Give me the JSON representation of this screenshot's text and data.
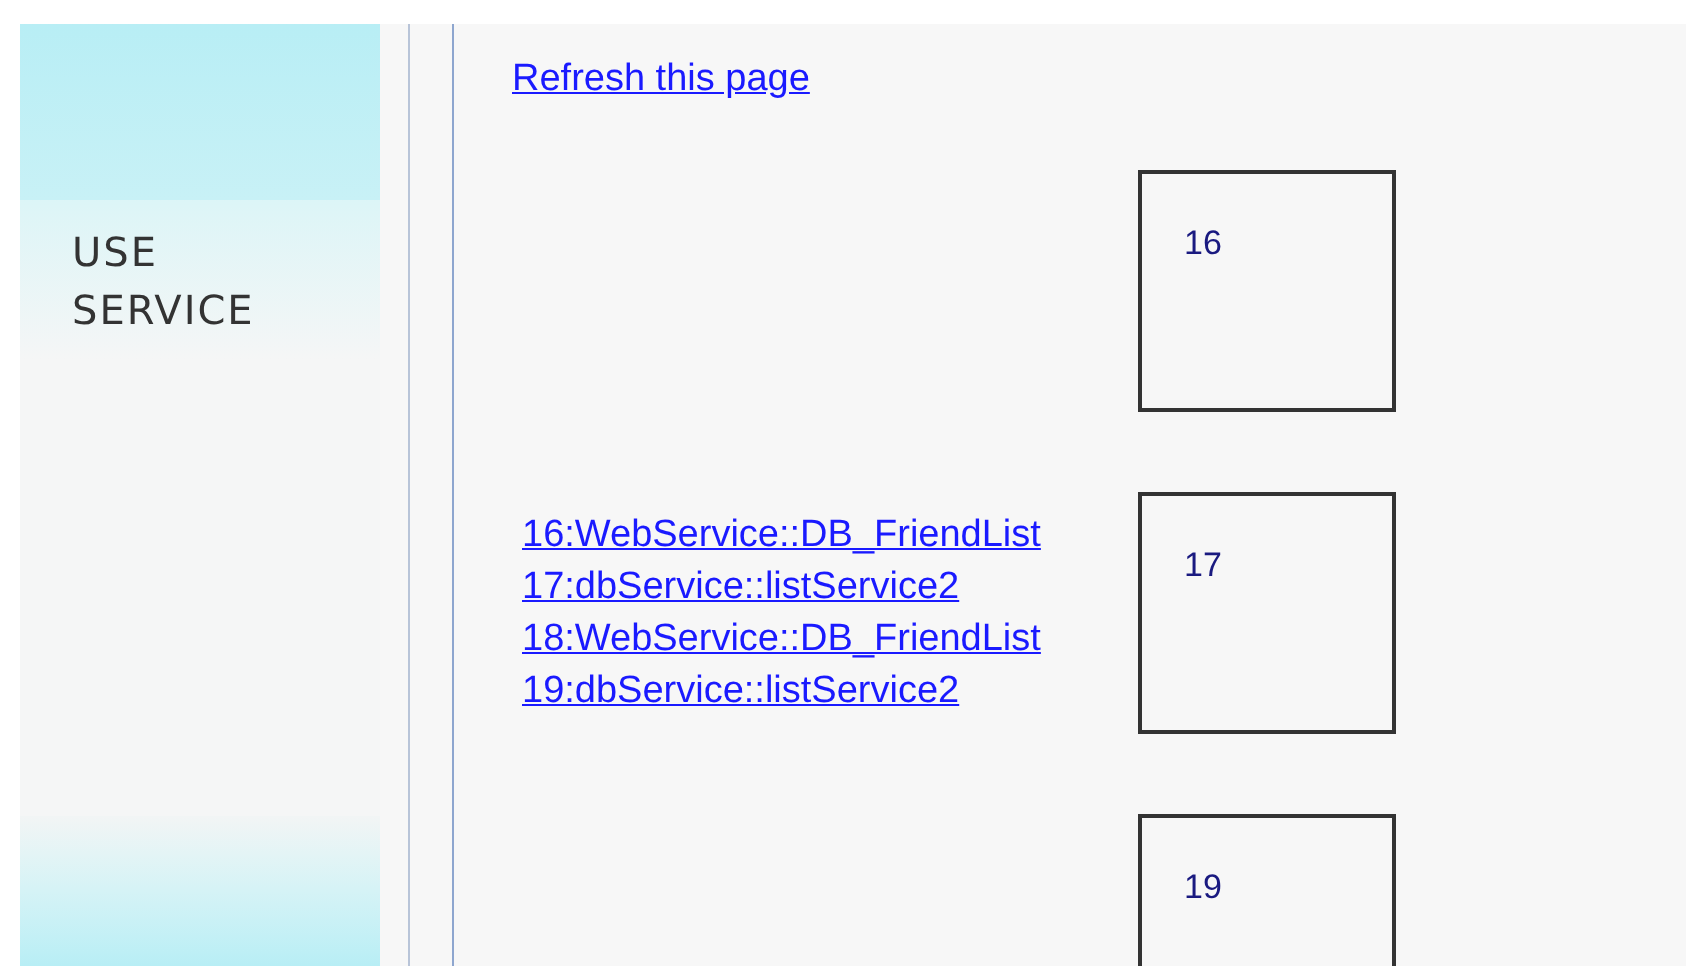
{
  "sidebar": {
    "title_lines": [
      "USE",
      "SERVICE"
    ]
  },
  "refresh_link": "Refresh this page",
  "blocks": [
    {
      "number": "16"
    },
    {
      "number": "17",
      "links": [
        "16:WebService::DB_FriendList",
        "17:dbService::listService2",
        "18:WebService::DB_FriendList",
        "19:dbService::listService2"
      ]
    },
    {
      "number": "19"
    }
  ]
}
